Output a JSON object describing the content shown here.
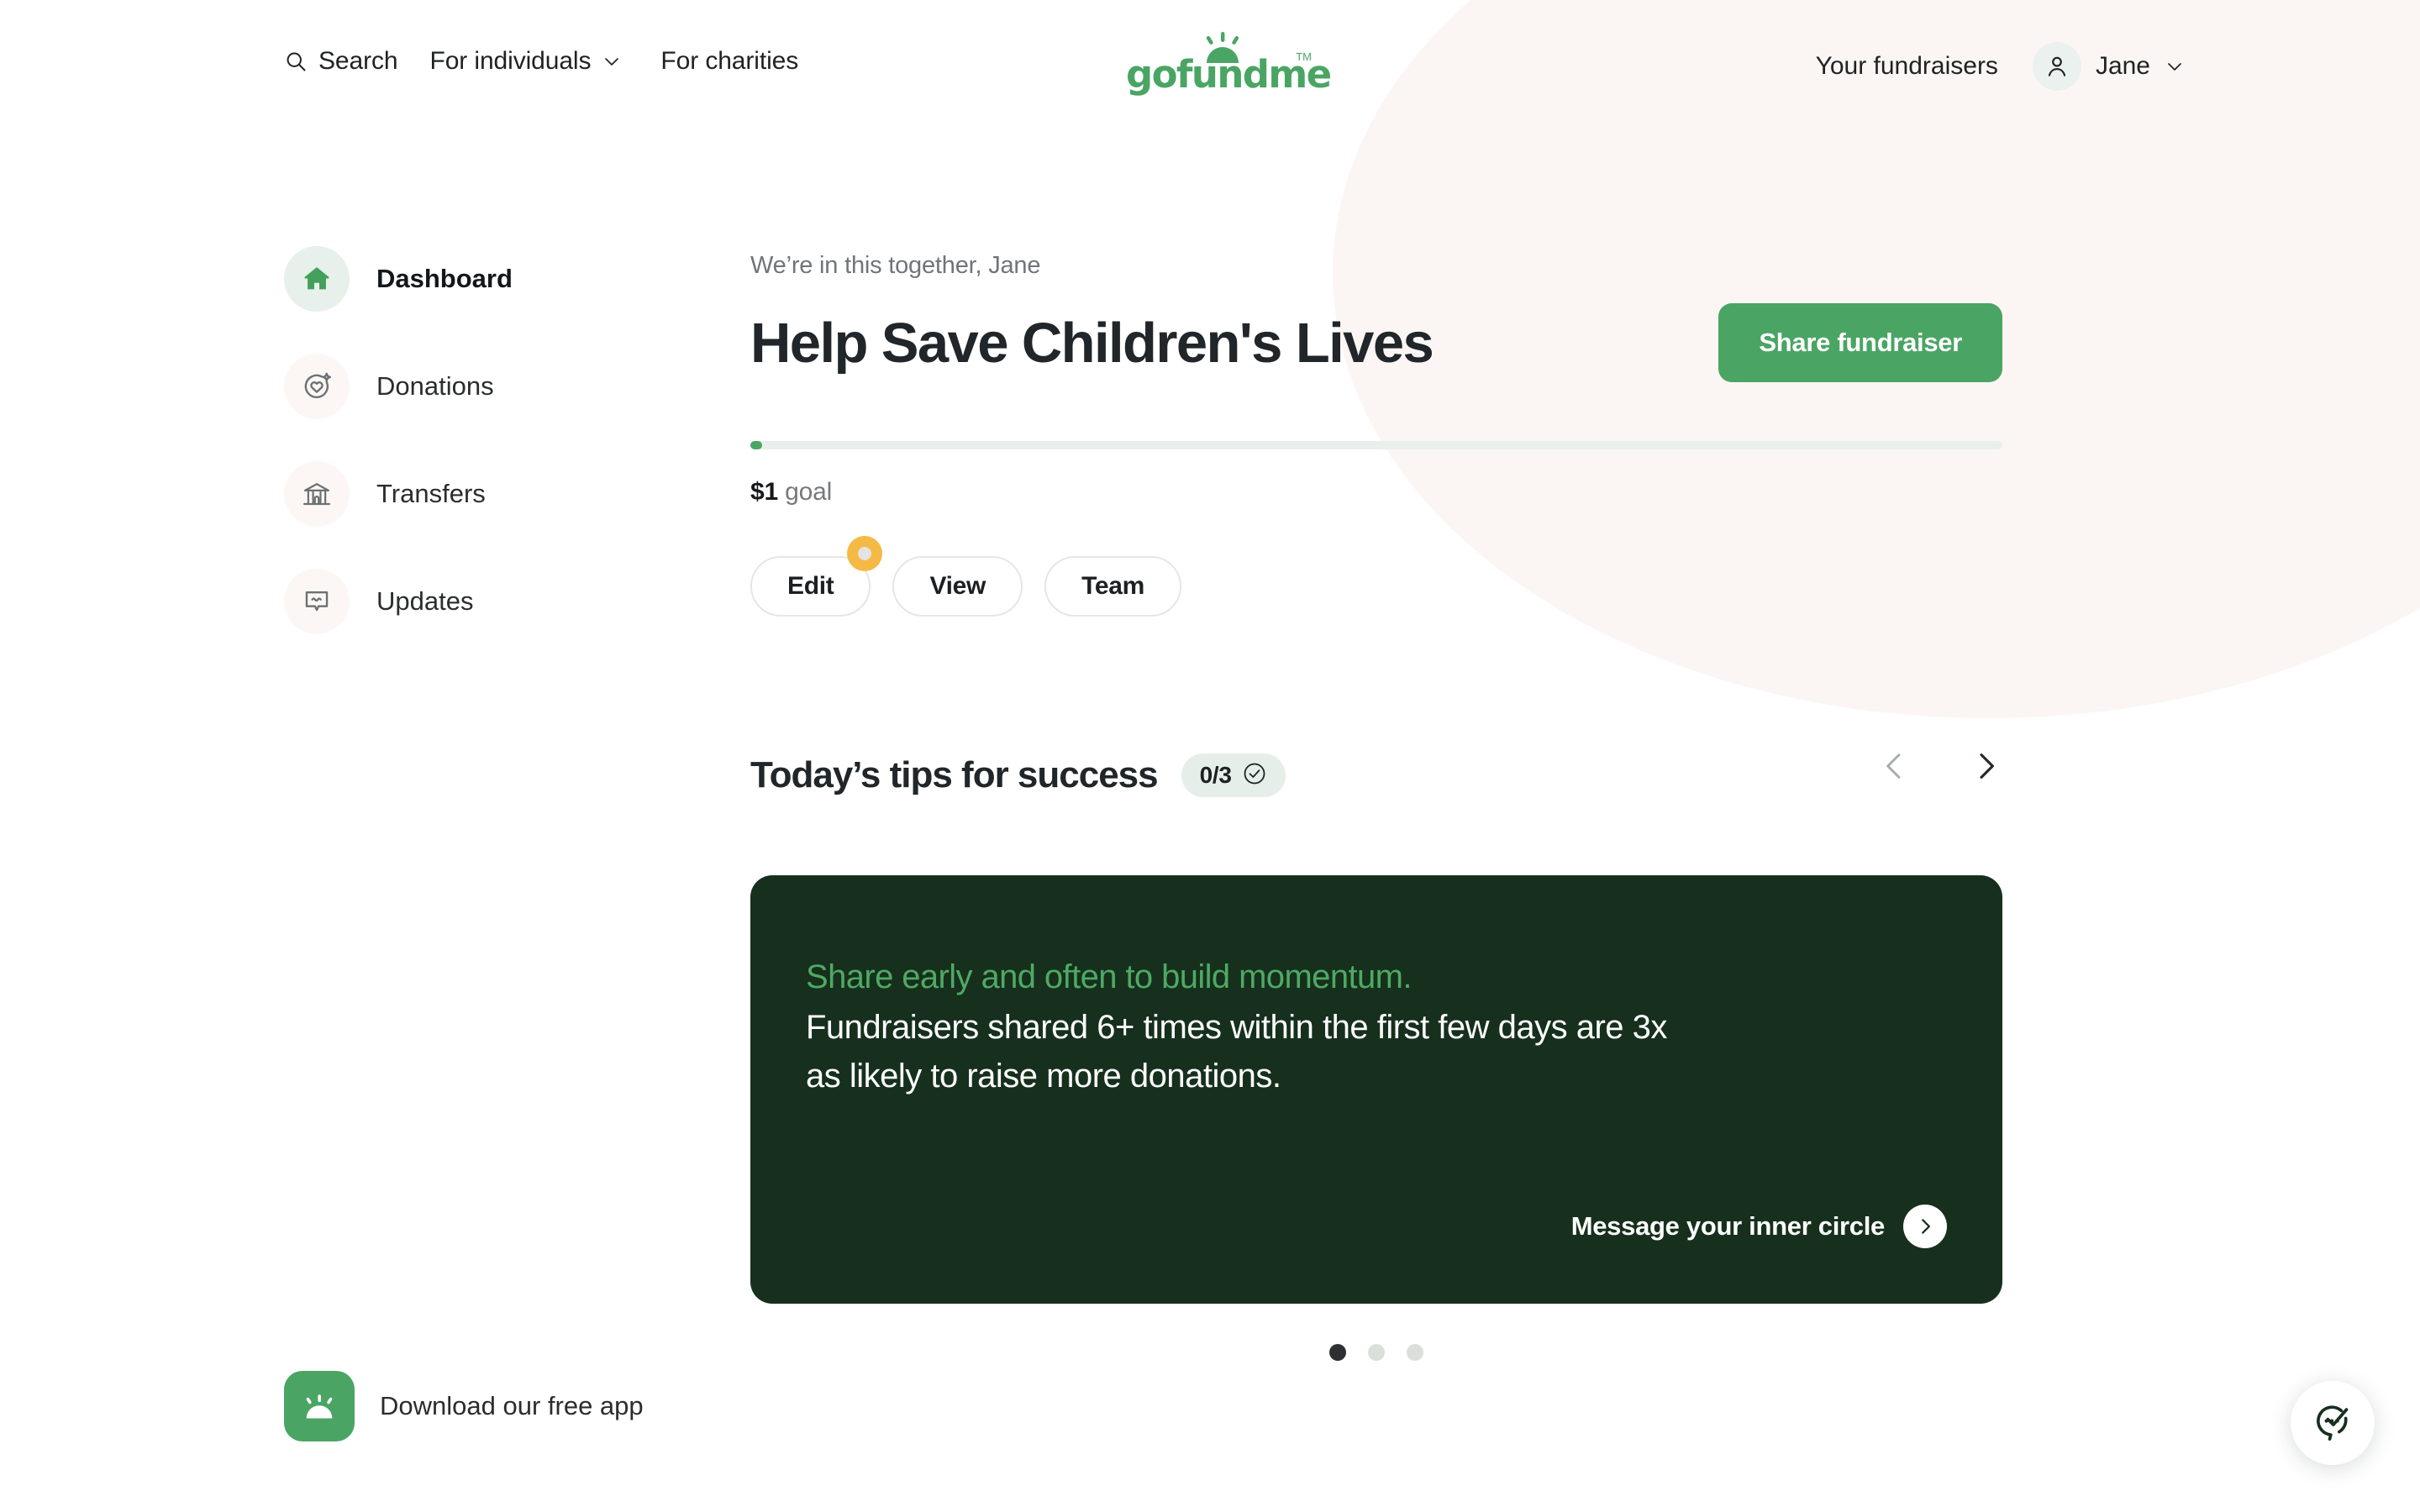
{
  "header": {
    "nav_left": [
      {
        "label": "Search",
        "icon": "search-icon"
      },
      {
        "label": "For individuals",
        "icon": "chevron-down-icon"
      },
      {
        "label": "For charities",
        "icon": ""
      }
    ],
    "logo_text": "gofundme",
    "logo_tm": "TM",
    "your_fundraisers": "Your fundraisers",
    "account_name": "Jane"
  },
  "sidebar": {
    "items": [
      {
        "label": "Dashboard",
        "icon": "home-icon",
        "active": true
      },
      {
        "label": "Donations",
        "icon": "donation-heart-icon",
        "active": false
      },
      {
        "label": "Transfers",
        "icon": "bank-icon",
        "active": false
      },
      {
        "label": "Updates",
        "icon": "chat-bubble-icon",
        "active": false
      }
    ],
    "app_download_label": "Download our free app",
    "app_icon": "gofundme-app-icon"
  },
  "main": {
    "greeting": "We’re in this together, Jane",
    "title": "Help Save Children's Lives",
    "share_button": "Share fundraiser",
    "goal_amount": "$1",
    "goal_suffix": "goal",
    "progress_percent": 1,
    "pills": [
      {
        "label": "Edit",
        "badge": true
      },
      {
        "label": "View",
        "badge": false
      },
      {
        "label": "Team",
        "badge": false
      }
    ]
  },
  "tips": {
    "title": "Today’s tips for success",
    "counter": "0/3",
    "counter_icon": "check-circle-icon",
    "prev_icon": "chevron-left-icon",
    "next_icon": "chevron-right-icon",
    "card": {
      "headline": "Share early and often to build momentum.",
      "body": "Fundraisers shared 6+ times within the first few days are 3x as likely to raise more donations.",
      "cta_label": "Message your inner circle",
      "cta_icon": "arrow-right-icon"
    },
    "dots": [
      true,
      false,
      false
    ]
  },
  "help": {
    "icon": "support-chat-check-icon"
  },
  "colors": {
    "brand_green": "#4aa564",
    "card_dark_green": "#16301d",
    "headline_green": "#4fa963",
    "badge_amber": "#f5b945",
    "blob": "#fbf6f4"
  }
}
